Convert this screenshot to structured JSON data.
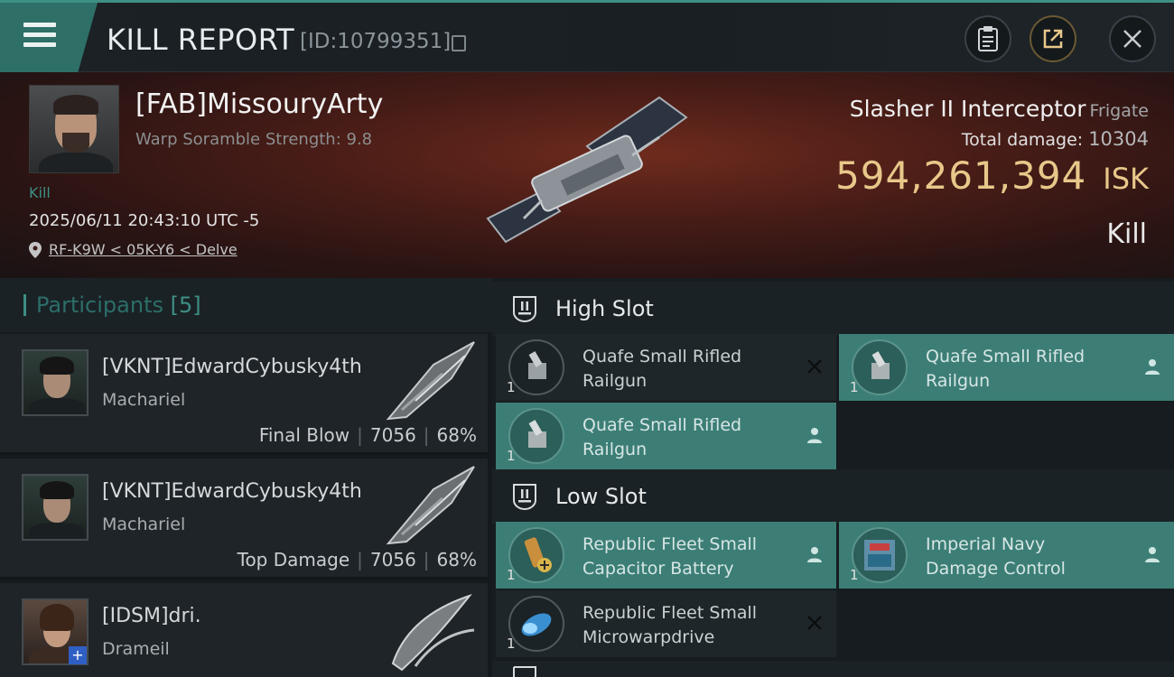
{
  "header": {
    "title": "KILL REPORT",
    "report_id": "[ID:10799351]"
  },
  "victim": {
    "name": "[FAB]MissouryArty",
    "warp_scramble": "Warp Soramble Strength: 9.8",
    "kill_tag": "Kill",
    "time": "2025/06/11 20:43:10 UTC -5",
    "location": "RF-K9W < 05K-Y6 < Delve",
    "ship_name": "Slasher II Interceptor",
    "ship_class": "Frigate",
    "total_damage_label": "Total damage:",
    "total_damage_value": "10304",
    "isk_value": "594,261,394",
    "isk_unit": "ISK",
    "result": "Kill"
  },
  "participants": {
    "title": "Participants",
    "count": "[5]",
    "items": [
      {
        "name": "[VKNT]EdwardCybusky4th",
        "ship": "Machariel",
        "role": "Final Blow",
        "damage": "7056",
        "percent": "68%"
      },
      {
        "name": "[VKNT]EdwardCybusky4th",
        "ship": "Machariel",
        "role": "Top Damage",
        "damage": "7056",
        "percent": "68%"
      },
      {
        "name": "[IDSM]dri.",
        "ship": "Drameil",
        "badge": "+"
      }
    ]
  },
  "fitting": {
    "high_slot_title": "High Slot",
    "low_slot_title": "Low Slot",
    "high": [
      {
        "qty": "1",
        "line1": "Quafe Small Rifled",
        "line2": "Railgun",
        "status": "destroyed"
      },
      {
        "qty": "1",
        "line1": "Quafe Small Rifled",
        "line2": "Railgun",
        "status": "dropped"
      },
      {
        "qty": "1",
        "line1": "Quafe Small Rifled",
        "line2": "Railgun",
        "status": "dropped"
      }
    ],
    "low": [
      {
        "qty": "1",
        "line1": "Republic Fleet Small",
        "line2": "Capacitor Battery",
        "status": "dropped"
      },
      {
        "qty": "1",
        "line1": "Imperial Navy",
        "line2": "Damage Control",
        "status": "dropped"
      },
      {
        "qty": "1",
        "line1": "Republic Fleet Small",
        "line2": "Microwarpdrive",
        "status": "destroyed"
      }
    ]
  },
  "colors": {
    "accent": "#3e8f84",
    "isk": "#e8c88a",
    "teal_slot": "#3c7e76"
  },
  "icons": [
    "menu-icon",
    "copy-icon",
    "clipboard-icon",
    "share-icon",
    "close-icon",
    "location-pin-icon",
    "slot-icon",
    "person-icon",
    "x-icon"
  ]
}
